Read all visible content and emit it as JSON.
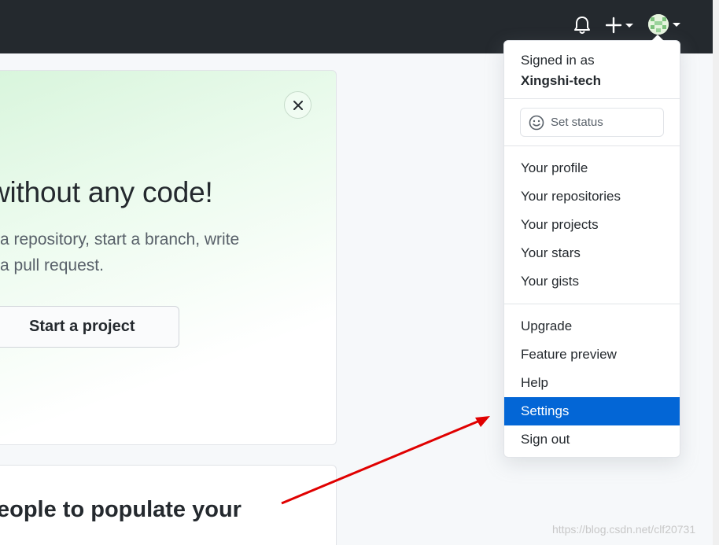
{
  "banner": {
    "title": "without any code!",
    "desc_line1": "a repository, start a branch, write",
    "desc_line2": "a pull request.",
    "start_button": "Start a project"
  },
  "card2": {
    "title": "eople to populate your"
  },
  "header": {
    "icons": [
      "bell-icon",
      "plus-icon",
      "avatar"
    ]
  },
  "menu": {
    "signed_in_label": "Signed in as",
    "username": "Xingshi-tech",
    "set_status": "Set status",
    "items": [
      "Your profile",
      "Your repositories",
      "Your projects",
      "Your stars",
      "Your gists",
      "Upgrade",
      "Feature preview",
      "Help",
      "Settings",
      "Sign out"
    ],
    "active_item": "Settings"
  },
  "watermark": "https://blog.csdn.net/clf20731",
  "colors": {
    "header_bg": "#24292e",
    "active_bg": "#0366d6",
    "annotation_arrow": "#e00000"
  }
}
